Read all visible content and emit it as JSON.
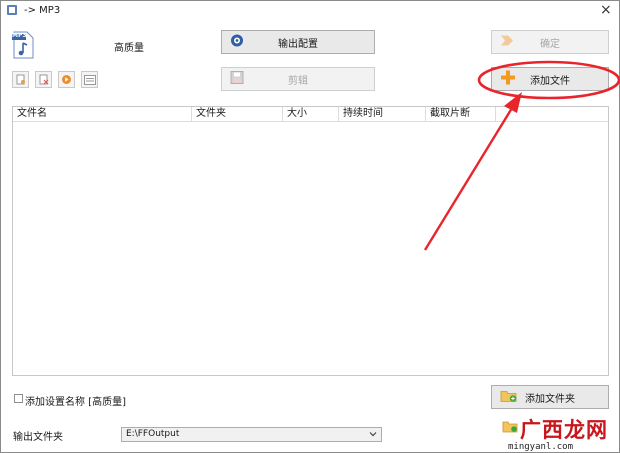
{
  "window": {
    "title": "-> MP3",
    "close_glyph": "×"
  },
  "preset": {
    "format_badge": "MP3",
    "name": "高质量"
  },
  "buttons": {
    "output_config": "输出配置",
    "ok": "确定",
    "clip": "剪辑",
    "add_file": "添加文件",
    "add_folder": "添加文件夹"
  },
  "table": {
    "columns": [
      "文件名",
      "文件夹",
      "大小",
      "持续时间",
      "截取片断"
    ],
    "rows": []
  },
  "options": {
    "append_setting_name_label": "添加设置名称 [高质量]",
    "append_setting_name_checked": false
  },
  "output": {
    "label": "输出文件夹",
    "folder": "E:\\FFOutput"
  },
  "watermark": {
    "text_main": "广西龙网",
    "text_url": "mingyanl.com"
  },
  "colors": {
    "annotation_red": "#e8252b",
    "accent_orange": "#f39a1e",
    "watermark_red": "#c8161d"
  }
}
